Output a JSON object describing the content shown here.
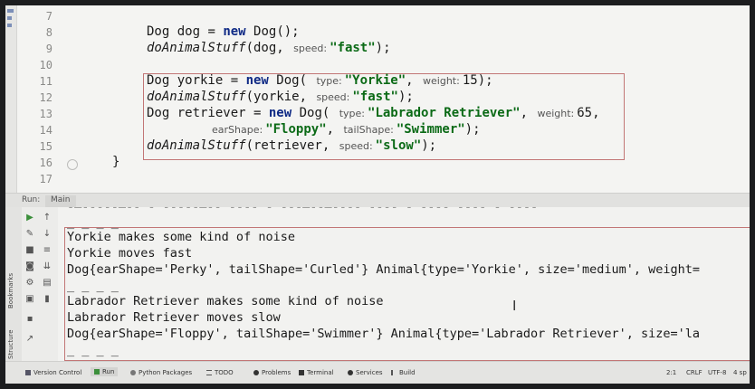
{
  "editor": {
    "line_numbers": [
      "7",
      "8",
      "9",
      "10",
      "11",
      "12",
      "13",
      "14",
      "15",
      "16",
      "17"
    ],
    "line8": {
      "type": "Dog",
      "var_decl": " dog = ",
      "kw": "new",
      "ctor": " Dog();"
    },
    "line9": {
      "fn": "doAnimalStuff",
      "args": "(dog, ",
      "hint": "speed:",
      "str": "\"fast\"",
      "end": ");"
    },
    "line11": {
      "pre": "Dog yorkie = ",
      "kw": "new",
      "ctor": " Dog( ",
      "hint1": "type:",
      "str1": "\"Yorkie\"",
      "sep": ", ",
      "hint2": "weight:",
      "num": "15",
      "end": ");"
    },
    "line12": {
      "fn": "doAnimalStuff",
      "args": "(yorkie, ",
      "hint": "speed:",
      "str": "\"fast\"",
      "end": ");"
    },
    "line13": {
      "pre": "Dog retriever = ",
      "kw": "new",
      "ctor": " Dog( ",
      "hint1": "type:",
      "str1": "\"Labrador Retriever\"",
      "sep": ", ",
      "hint2": "weight:",
      "num": "65",
      "end": ","
    },
    "line14": {
      "hint1": "earShape:",
      "str1": "\"Floppy\"",
      "sep": ", ",
      "hint2": "tailShape:",
      "str2": "\"Swimmer\"",
      "end": ");"
    },
    "line15": {
      "fn": "doAnimalStuff",
      "args": "(retriever, ",
      "hint": "speed:",
      "str": "\"slow\"",
      "end": ");"
    },
    "line16": {
      "brace": "}"
    }
  },
  "run_window": {
    "label": "Run:",
    "tab": "Main",
    "cut_line": "‐–‑‑‐‐‑–‑‐ ‑ ‑‑‐‐‑–‑‐ ‑‐‐‑ ‑ ‐‑‑–‐‐–‑‑‐‐ ‑‐‑‐ ‑ ‑‐‑‐ ‑‐‐‑ ‑ ‑‐‑‐",
    "output": [
      "_ _ _ _",
      "Yorkie makes some kind of noise",
      "Yorkie moves fast",
      "Dog{earShape='Perky', tailShape='Curled'} Animal{type='Yorkie', size='medium', weight=",
      "_ _ _ _",
      "Labrador Retriever makes some kind of noise",
      "Labrador Retriever moves slow",
      "Dog{earShape='Floppy', tailShape='Swimmer'} Animal{type='Labrador Retriever', size='la",
      "_ _ _ _"
    ],
    "side_labels": {
      "bookmarks": "Bookmarks",
      "structure": "Structure"
    }
  },
  "statusbar": {
    "items": [
      "Version Control",
      "Run",
      "Python Packages",
      "TODO",
      "Problems",
      "Terminal",
      "Services",
      "Build"
    ],
    "right": [
      "2:1",
      "CRLF",
      "UTF-8",
      "4 sp"
    ]
  },
  "colors": {
    "keyword": "#0f2a85",
    "string": "#0b6a16",
    "highlight_box": "#c27676"
  }
}
